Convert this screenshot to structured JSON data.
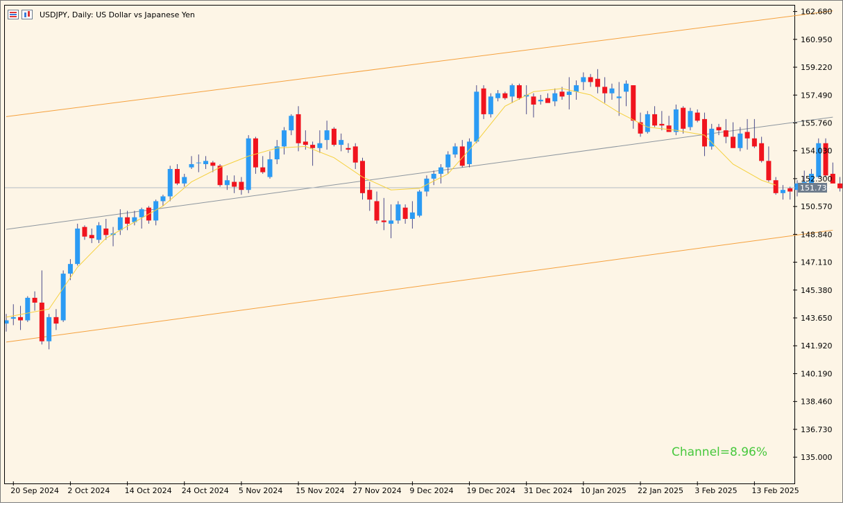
{
  "header": {
    "title": "USDJPY, Daily:  US Dollar vs Japanese Yen",
    "icons": [
      "chart-list-icon",
      "chart-bars-icon"
    ]
  },
  "channel_label": "Channel=8.96%",
  "current_price_label": "151.736",
  "colors": {
    "background": "#fdf5e6",
    "bull": "#2b9bf4",
    "bear": "#f0141e",
    "wick": "#4a4a8a",
    "channel": "#f5a03c",
    "mid_line": "#8c959e",
    "smooth_line": "#f5d03c",
    "price_line": "#b4bcc4",
    "price_tag": "#6e7c8c",
    "channel_text": "#46c83c"
  },
  "chart_data": {
    "type": "candlestick",
    "title": "USDJPY, Daily:  US Dollar vs Japanese Yen",
    "y_range": [
      133.37,
      163.05
    ],
    "y_ticks": [
      "162.680",
      "160.950",
      "159.220",
      "157.490",
      "155.760",
      "154.030",
      "152.300",
      "150.570",
      "148.840",
      "147.110",
      "145.380",
      "143.650",
      "141.920",
      "140.190",
      "138.460",
      "136.730",
      "135.000"
    ],
    "x_ticks": [
      {
        "label": "20 Sep 2024",
        "index": 1
      },
      {
        "label": "2 Oct 2024",
        "index": 9
      },
      {
        "label": "14 Oct 2024",
        "index": 17
      },
      {
        "label": "24 Oct 2024",
        "index": 25
      },
      {
        "label": "5 Nov 2024",
        "index": 33
      },
      {
        "label": "15 Nov 2024",
        "index": 41
      },
      {
        "label": "27 Nov 2024",
        "index": 49
      },
      {
        "label": "9 Dec 2024",
        "index": 57
      },
      {
        "label": "19 Dec 2024",
        "index": 65
      },
      {
        "label": "31 Dec 2024",
        "index": 73
      },
      {
        "label": "10 Jan 2025",
        "index": 81
      },
      {
        "label": "22 Jan 2025",
        "index": 89
      },
      {
        "label": "3 Feb 2025",
        "index": 97
      },
      {
        "label": "13 Feb 2025",
        "index": 105
      }
    ],
    "candles": [
      [
        143.3,
        143.9,
        142.8,
        143.5
      ],
      [
        143.6,
        144.5,
        143.2,
        143.7
      ],
      [
        143.7,
        144.4,
        142.9,
        143.5
      ],
      [
        143.5,
        145.0,
        143.4,
        144.9
      ],
      [
        144.9,
        145.3,
        144.1,
        144.6
      ],
      [
        144.6,
        146.6,
        142.0,
        142.2
      ],
      [
        142.2,
        143.9,
        141.7,
        143.7
      ],
      [
        143.7,
        144.2,
        142.9,
        143.3
      ],
      [
        143.5,
        146.6,
        143.4,
        146.4
      ],
      [
        146.4,
        147.3,
        146.0,
        147.0
      ],
      [
        147.0,
        149.5,
        146.9,
        149.2
      ],
      [
        149.3,
        149.4,
        148.5,
        148.7
      ],
      [
        148.8,
        149.2,
        148.3,
        148.6
      ],
      [
        148.5,
        149.6,
        148.3,
        149.4
      ],
      [
        149.2,
        149.8,
        148.5,
        148.8
      ],
      [
        148.8,
        149.3,
        148.1,
        148.9
      ],
      [
        149.1,
        150.4,
        148.8,
        149.9
      ],
      [
        149.9,
        150.3,
        149.1,
        149.5
      ],
      [
        149.6,
        150.3,
        149.4,
        149.9
      ],
      [
        149.9,
        150.5,
        149.2,
        150.4
      ],
      [
        150.5,
        150.6,
        149.5,
        149.7
      ],
      [
        149.7,
        151.0,
        149.4,
        150.9
      ],
      [
        150.9,
        151.3,
        150.6,
        151.2
      ],
      [
        151.2,
        153.1,
        150.9,
        152.9
      ],
      [
        152.9,
        153.2,
        151.9,
        152.0
      ],
      [
        152.0,
        152.6,
        151.8,
        152.4
      ],
      [
        153.0,
        153.7,
        152.9,
        153.2
      ],
      [
        153.3,
        153.8,
        152.7,
        153.3
      ],
      [
        153.2,
        153.7,
        152.9,
        153.4
      ],
      [
        153.3,
        153.4,
        152.7,
        153.1
      ],
      [
        153.1,
        153.2,
        151.8,
        151.9
      ],
      [
        151.9,
        152.5,
        151.6,
        152.2
      ],
      [
        152.1,
        152.5,
        151.4,
        151.8
      ],
      [
        152.1,
        152.4,
        151.3,
        151.6
      ],
      [
        151.6,
        155.0,
        151.4,
        154.8
      ],
      [
        154.8,
        154.9,
        152.6,
        153.0
      ],
      [
        153.0,
        153.7,
        152.6,
        152.7
      ],
      [
        152.4,
        154.0,
        152.3,
        153.5
      ],
      [
        153.5,
        154.7,
        153.2,
        154.3
      ],
      [
        154.3,
        155.5,
        153.8,
        155.3
      ],
      [
        155.3,
        156.3,
        155.0,
        156.2
      ],
      [
        156.3,
        156.8,
        154.0,
        154.5
      ],
      [
        154.6,
        155.3,
        154.1,
        154.4
      ],
      [
        154.4,
        154.6,
        153.1,
        154.2
      ],
      [
        154.2,
        155.3,
        153.9,
        154.5
      ],
      [
        154.7,
        155.9,
        154.1,
        155.3
      ],
      [
        155.4,
        155.5,
        154.3,
        154.4
      ],
      [
        154.4,
        155.1,
        154.0,
        154.7
      ],
      [
        154.2,
        154.5,
        153.9,
        154.1
      ],
      [
        154.3,
        154.5,
        152.9,
        153.3
      ],
      [
        153.4,
        153.6,
        151.0,
        151.4
      ],
      [
        151.6,
        152.1,
        150.3,
        151.0
      ],
      [
        150.9,
        151.5,
        149.5,
        149.7
      ],
      [
        149.7,
        151.1,
        149.1,
        149.6
      ],
      [
        149.5,
        150.7,
        148.6,
        149.7
      ],
      [
        149.7,
        150.9,
        149.5,
        150.7
      ],
      [
        150.5,
        150.7,
        149.5,
        149.8
      ],
      [
        149.8,
        150.9,
        149.2,
        150.2
      ],
      [
        150.0,
        151.6,
        149.9,
        151.5
      ],
      [
        151.5,
        152.5,
        151.2,
        152.3
      ],
      [
        152.3,
        152.8,
        151.9,
        152.6
      ],
      [
        152.6,
        153.2,
        152.0,
        153.0
      ],
      [
        153.0,
        154.0,
        152.6,
        153.8
      ],
      [
        153.8,
        154.5,
        153.6,
        154.3
      ],
      [
        154.3,
        154.7,
        153.0,
        153.1
      ],
      [
        153.2,
        154.8,
        153.0,
        154.6
      ],
      [
        154.6,
        158.1,
        154.5,
        157.7
      ],
      [
        157.9,
        158.1,
        156.0,
        156.3
      ],
      [
        156.3,
        157.6,
        156.1,
        157.4
      ],
      [
        157.3,
        157.8,
        157.1,
        157.6
      ],
      [
        157.6,
        157.7,
        157.2,
        157.3
      ],
      [
        157.4,
        158.2,
        157.0,
        158.1
      ],
      [
        158.1,
        158.2,
        157.2,
        157.3
      ],
      [
        157.4,
        158.1,
        156.3,
        157.5
      ],
      [
        157.4,
        157.6,
        156.1,
        156.9
      ],
      [
        157.1,
        157.5,
        156.9,
        157.2
      ],
      [
        157.3,
        157.6,
        157.1,
        157.0
      ],
      [
        157.1,
        157.9,
        156.8,
        157.6
      ],
      [
        157.7,
        158.0,
        157.2,
        157.4
      ],
      [
        157.5,
        158.6,
        156.6,
        157.7
      ],
      [
        157.7,
        158.4,
        157.2,
        158.1
      ],
      [
        158.3,
        158.9,
        157.8,
        158.6
      ],
      [
        158.6,
        158.8,
        158.0,
        158.3
      ],
      [
        158.5,
        159.1,
        157.6,
        158.0
      ],
      [
        158.0,
        158.6,
        157.0,
        157.6
      ],
      [
        157.6,
        158.2,
        157.2,
        157.9
      ],
      [
        157.3,
        158.3,
        156.2,
        157.4
      ],
      [
        157.7,
        158.4,
        156.8,
        158.2
      ],
      [
        158.1,
        158.1,
        155.4,
        155.9
      ],
      [
        155.8,
        156.4,
        154.9,
        155.1
      ],
      [
        155.2,
        156.5,
        155.1,
        156.3
      ],
      [
        156.3,
        156.8,
        155.5,
        155.6
      ],
      [
        155.7,
        156.5,
        155.3,
        155.6
      ],
      [
        155.6,
        156.2,
        155.4,
        155.2
      ],
      [
        155.2,
        156.9,
        155.0,
        156.6
      ],
      [
        156.7,
        156.8,
        155.1,
        155.4
      ],
      [
        155.5,
        156.7,
        155.3,
        156.5
      ],
      [
        156.4,
        156.6,
        155.8,
        155.9
      ],
      [
        156.0,
        156.4,
        153.7,
        154.3
      ],
      [
        154.3,
        155.7,
        154.1,
        155.4
      ],
      [
        155.5,
        155.7,
        155.0,
        155.3
      ],
      [
        155.3,
        156.0,
        154.5,
        154.9
      ],
      [
        154.9,
        155.8,
        154.2,
        154.2
      ],
      [
        154.2,
        155.5,
        154.0,
        155.1
      ],
      [
        155.2,
        156.0,
        154.1,
        154.8
      ],
      [
        154.8,
        156.0,
        154.2,
        154.3
      ],
      [
        154.5,
        154.9,
        153.3,
        153.4
      ],
      [
        153.4,
        154.3,
        152.1,
        152.2
      ],
      [
        152.2,
        152.4,
        151.3,
        151.4
      ],
      [
        151.4,
        151.9,
        151.0,
        151.6
      ],
      [
        151.7,
        151.8,
        151.0,
        151.5
      ],
      [
        151.6,
        152.2,
        151.2,
        152.0
      ],
      [
        152.0,
        152.8,
        151.9,
        152.1
      ],
      [
        152.0,
        152.9,
        151.6,
        152.6
      ],
      [
        152.4,
        154.8,
        152.3,
        154.5
      ],
      [
        154.5,
        154.8,
        152.4,
        152.5
      ],
      [
        152.6,
        153.3,
        152.1,
        152.0
      ],
      [
        152.0,
        152.4,
        151.5,
        151.7
      ]
    ],
    "upper_channel": {
      "start": [
        0,
        156.15
      ],
      "end": [
        116,
        162.72
      ]
    },
    "mid_line": {
      "start": [
        0,
        149.15
      ],
      "end": [
        116,
        156.12
      ]
    },
    "lower_channel": {
      "start": [
        0,
        142.15
      ],
      "end": [
        116,
        149.1
      ]
    },
    "smooth_line": [
      [
        0,
        143.7
      ],
      [
        6,
        144.2
      ],
      [
        10,
        146.8
      ],
      [
        14,
        148.6
      ],
      [
        18,
        149.6
      ],
      [
        22,
        150.6
      ],
      [
        26,
        152.1
      ],
      [
        30,
        153.0
      ],
      [
        34,
        153.7
      ],
      [
        38,
        154.2
      ],
      [
        42,
        154.3
      ],
      [
        46,
        153.6
      ],
      [
        50,
        152.4
      ],
      [
        54,
        151.6
      ],
      [
        58,
        151.7
      ],
      [
        62,
        152.6
      ],
      [
        66,
        154.6
      ],
      [
        70,
        156.8
      ],
      [
        74,
        157.7
      ],
      [
        78,
        157.9
      ],
      [
        82,
        157.5
      ],
      [
        86,
        156.4
      ],
      [
        90,
        155.5
      ],
      [
        94,
        155.3
      ],
      [
        98,
        155.0
      ],
      [
        102,
        153.2
      ],
      [
        106,
        152.2
      ],
      [
        108,
        151.9
      ]
    ]
  }
}
